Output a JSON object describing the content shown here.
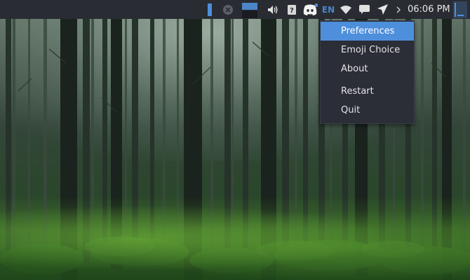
{
  "panel": {
    "language": "EN",
    "clock": "06:06 PM",
    "icons": [
      "blue-bar-indicator-icon",
      "mail-icon",
      "window-preview-icon",
      "volume-icon",
      "clipboard-question-icon",
      "discord-icon",
      "wifi-icon",
      "chat-icon",
      "send-arrow-icon",
      "chevron-right-icon",
      "panel-menu-icon"
    ],
    "accent": "#4e8fdc"
  },
  "menu": {
    "items": [
      {
        "label": "Preferences",
        "active": true
      },
      {
        "label": "Emoji Choice",
        "active": false
      },
      {
        "label": "About",
        "active": false
      },
      {
        "label": "Restart",
        "active": false
      },
      {
        "label": "Quit",
        "active": false
      }
    ]
  }
}
